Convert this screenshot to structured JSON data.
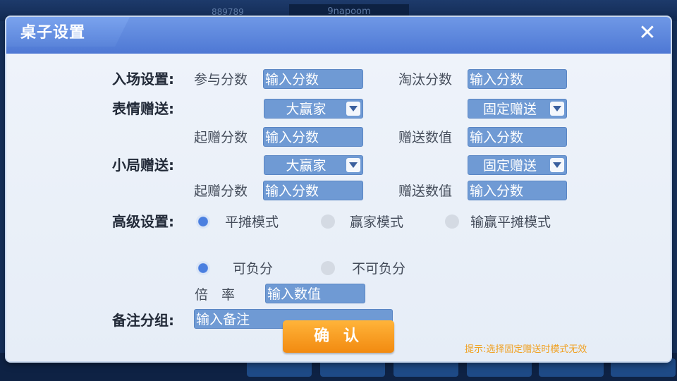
{
  "background": {
    "tag": "9napoom",
    "number": "889789",
    "bottom_buttons": [
      "",
      "",
      "",
      "",
      "",
      ""
    ]
  },
  "dialog": {
    "title": "桌子设置",
    "close_icon": "close-icon",
    "entry": {
      "label": "入场设置:",
      "join_label": "参与分数",
      "join_placeholder": "输入分数",
      "elim_label": "淘汰分数",
      "elim_placeholder": "输入分数"
    },
    "emote": {
      "label": "表情赠送:",
      "select_left": "大赢家",
      "select_right": "固定赠送",
      "start_label": "起赠分数",
      "start_placeholder": "输入分数",
      "value_label": "赠送数值",
      "value_placeholder": "输入分数"
    },
    "round": {
      "label": "小局赠送:",
      "select_left": "大赢家",
      "select_right": "固定赠送",
      "start_label": "起赠分数",
      "start_placeholder": "输入分数",
      "value_label": "赠送数值",
      "value_placeholder": "输入分数"
    },
    "advanced": {
      "label": "高级设置:",
      "mode_options": [
        "平摊模式",
        "赢家模式",
        "输赢平摊模式"
      ],
      "mode_selected": 0,
      "negative_options": [
        "可负分",
        "不可负分"
      ],
      "negative_selected": 0,
      "multiplier_label": "倍　率",
      "multiplier_placeholder": "输入数值"
    },
    "remark": {
      "label": "备注分组:",
      "placeholder": "输入备注"
    },
    "confirm_label": "确 认",
    "hint": "提示:选择固定赠送时模式无效"
  },
  "colors": {
    "title_bar": "#5a84da",
    "input_bg": "#6f9ad4",
    "confirm": "#f59a1e",
    "hint": "#f0a020"
  }
}
